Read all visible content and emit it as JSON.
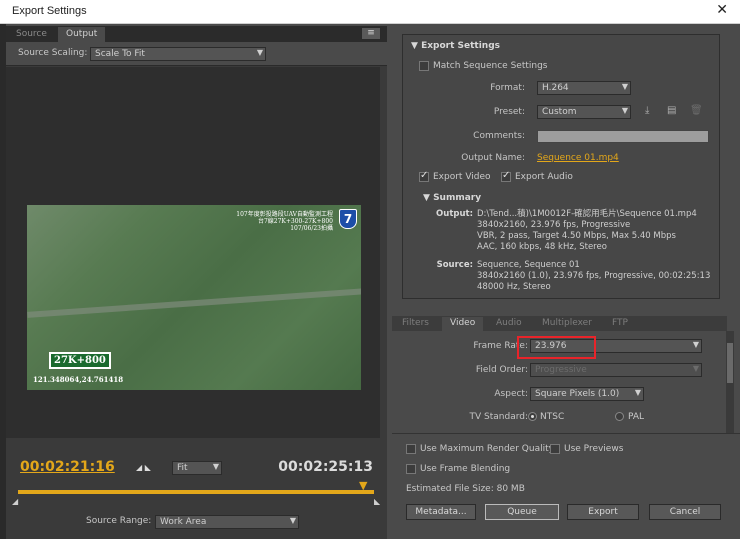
{
  "window": {
    "title": "Export Settings",
    "close": "✕"
  },
  "source_tabs": [
    {
      "label": "Source"
    },
    {
      "label": "Output"
    }
  ],
  "source_scaling": {
    "label": "Source Scaling:",
    "value": "Scale To Fit"
  },
  "overlay": {
    "line1": "107年度彰投路段UAV自動監測工程",
    "line2": "台7線27K+300-27K+800",
    "line3": "107/06/23拍攝",
    "route_number": "7",
    "km_marker": "27K+800",
    "coords": "121.348064,24.761418"
  },
  "timeline": {
    "current_time": "00:02:21:16",
    "end_time": "00:02:25:13",
    "zoom": "Fit",
    "source_range_label": "Source Range:",
    "source_range_value": "Work Area"
  },
  "export_settings": {
    "header": "Export Settings",
    "match_sequence": "Match Sequence Settings",
    "format_label": "Format:",
    "format_value": "H.264",
    "preset_label": "Preset:",
    "preset_value": "Custom",
    "comments_label": "Comments:",
    "output_name_label": "Output Name:",
    "output_name_value": "Sequence 01.mp4",
    "export_video": "Export Video",
    "export_audio": "Export Audio",
    "summary_header": "Summary",
    "output_label": "Output:",
    "output_lines": [
      "D:\\Tend...積)\\1M0012F-確認用毛片\\Sequence 01.mp4",
      "3840x2160, 23.976 fps, Progressive",
      "VBR, 2 pass, Target 4.50 Mbps, Max 5.40 Mbps",
      "AAC, 160 kbps, 48 kHz, Stereo"
    ],
    "source_label": "Source:",
    "source_lines": [
      "Sequence, Sequence 01",
      "3840x2160 (1.0), 23.976 fps, Progressive, 00:02:25:13",
      "48000 Hz, Stereo"
    ]
  },
  "settings_tabs": [
    {
      "label": "Filters"
    },
    {
      "label": "Video"
    },
    {
      "label": "Audio"
    },
    {
      "label": "Multiplexer"
    },
    {
      "label": "FTP"
    }
  ],
  "video": {
    "frame_rate_label": "Frame Rate:",
    "frame_rate_value": "23.976",
    "field_order_label": "Field Order:",
    "field_order_value": "Progressive",
    "aspect_label": "Aspect:",
    "aspect_value": "Square Pixels (1.0)",
    "tv_standard_label": "TV Standard:",
    "ntsc": "NTSC",
    "pal": "PAL"
  },
  "bottom": {
    "max_render": "Use Maximum Render Quality",
    "use_previews": "Use Previews",
    "frame_blending": "Use Frame Blending",
    "file_size": "Estimated File Size:  80 MB",
    "metadata": "Metadata...",
    "queue": "Queue",
    "export": "Export",
    "cancel": "Cancel"
  }
}
